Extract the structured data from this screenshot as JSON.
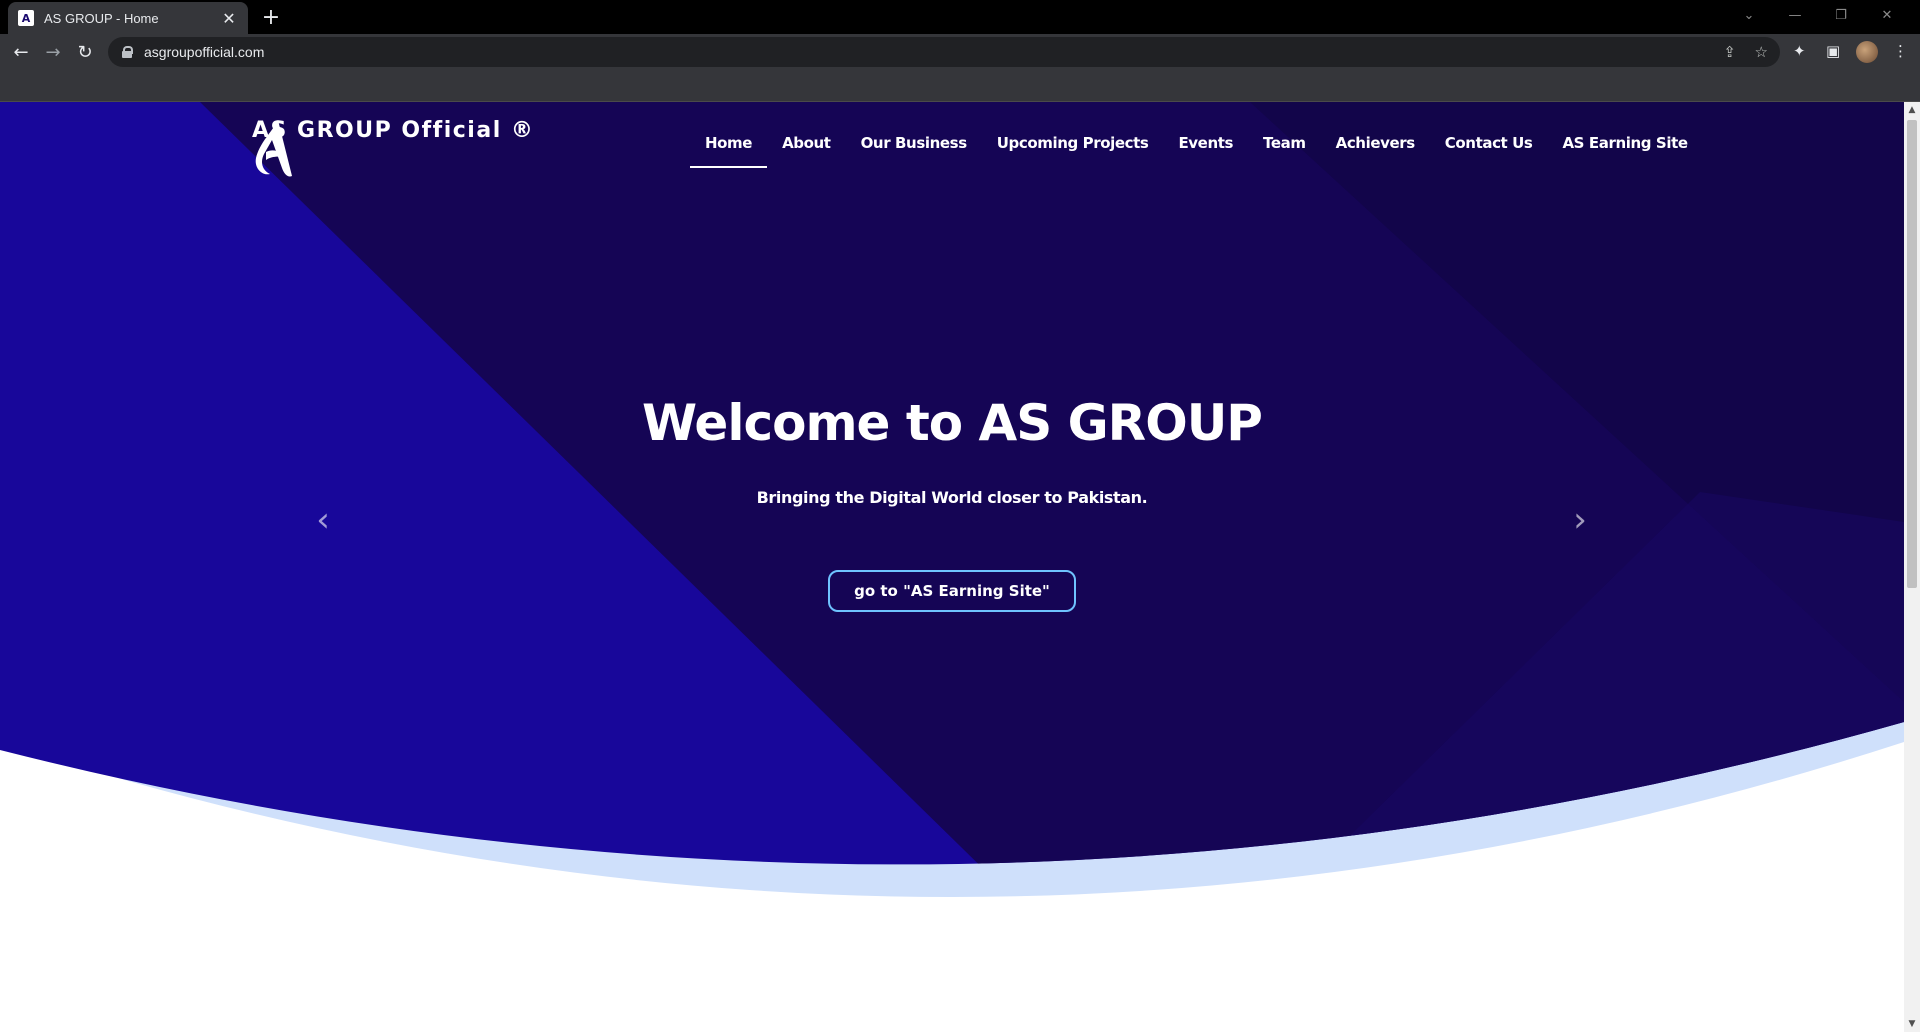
{
  "browser": {
    "tab_title": "AS GROUP - Home",
    "tab_close": "✕",
    "new_tab": "+",
    "url": "asgroupofficial.com",
    "window_controls": {
      "dropdown": "⌄",
      "minimize": "—",
      "restore": "❐",
      "close": "✕"
    },
    "toolbar_glyphs": {
      "back": "←",
      "forward": "→",
      "reload": "↻",
      "share": "⇪",
      "star": "☆",
      "extensions": "✦",
      "side_panel": "▣",
      "menu": "⋮"
    },
    "icons": [
      "back-icon",
      "forward-icon",
      "reload-icon",
      "lock-icon",
      "share-icon",
      "star-icon",
      "extensions-icon",
      "side-panel-icon",
      "profile-avatar",
      "menu-icon"
    ]
  },
  "site": {
    "logo_text": "AS GROUP Official ®",
    "nav": [
      {
        "label": "Home",
        "active": true
      },
      {
        "label": "About"
      },
      {
        "label": "Our Business"
      },
      {
        "label": "Upcoming Projects"
      },
      {
        "label": "Events"
      },
      {
        "label": "Team"
      },
      {
        "label": "Achievers"
      },
      {
        "label": "Contact Us"
      },
      {
        "label": "AS Earning Site"
      }
    ],
    "hero": {
      "title": "Welcome to AS GROUP",
      "subtitle": "Bringing the Digital World closer to Pakistan.",
      "cta": "go to \"AS Earning Site\"",
      "prev_arrow": "‹",
      "next_arrow": "›"
    },
    "colors": {
      "hero_blue": "#18079a",
      "hero_dark": "#150555",
      "wave_light": "#cfe0fb",
      "cta_border": "#6fc3ff"
    }
  },
  "scrollbar": {
    "up": "▲",
    "down": "▼"
  }
}
